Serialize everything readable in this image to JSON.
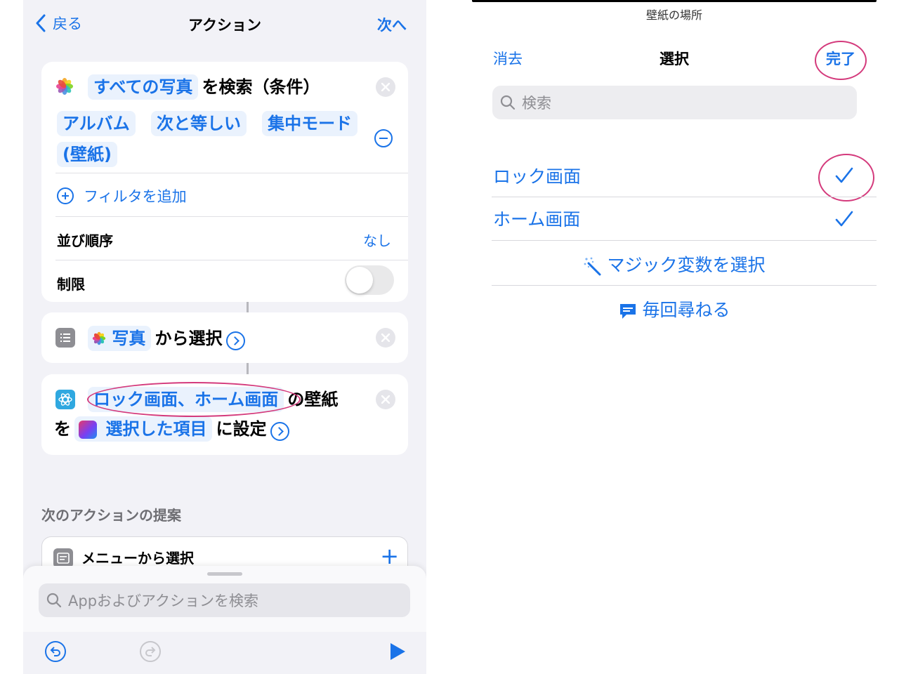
{
  "left_screen": {
    "nav": {
      "back_label": "戻る",
      "title": "アクション",
      "next_label": "次へ"
    },
    "find_photos_action": {
      "token_all_photos": "すべての写真",
      "text_search": "を検索（条件）",
      "filter_album": "アルバム",
      "filter_equals": "次と等しい",
      "filter_value_line1": "集中モード",
      "filter_value_line2": "(壁紙)",
      "add_filter_label": "フィルタを追加",
      "sort_label": "並び順序",
      "sort_value": "なし",
      "limit_label": "制限",
      "limit_on": false
    },
    "select_photos_action": {
      "token_photos": "写真",
      "text_from": "から選択"
    },
    "set_wallpaper_action": {
      "token_locations": "ロック画面、ホーム画面",
      "text_wallpaper": "の壁紙",
      "text_wo": "を",
      "token_selected": "選択した項目",
      "text_set": "に設定"
    },
    "suggestions": {
      "header": "次のアクションの提案",
      "items": [
        {
          "label": "メニューから選択"
        }
      ]
    },
    "bottom_sheet": {
      "search_placeholder": "Appおよびアクションを検索"
    }
  },
  "right_screen": {
    "header": "壁紙の場所",
    "cancel_label": "消去",
    "title": "選択",
    "done_label": "完了",
    "search_placeholder": "検索",
    "options": [
      {
        "label": "ロック画面",
        "checked": true
      },
      {
        "label": "ホーム画面",
        "checked": true
      }
    ],
    "magic_variable_label": "マジック変数を選択",
    "ask_each_time_label": "毎回尋ねる"
  },
  "colors": {
    "accent": "#1a73e8",
    "annotation": "#d43a7c",
    "background": "#f2f2f7"
  },
  "icons": [
    "chevron-left-icon",
    "photos-icon",
    "close-icon",
    "minus-circle-icon",
    "plus-circle-icon",
    "list-icon",
    "chevron-circle-icon",
    "wallpaper-icon",
    "shortcuts-icon",
    "menu-icon",
    "plus-icon",
    "search-icon",
    "undo-icon",
    "redo-icon",
    "play-icon",
    "checkmark-icon",
    "magic-wand-icon",
    "chat-bubble-icon"
  ]
}
